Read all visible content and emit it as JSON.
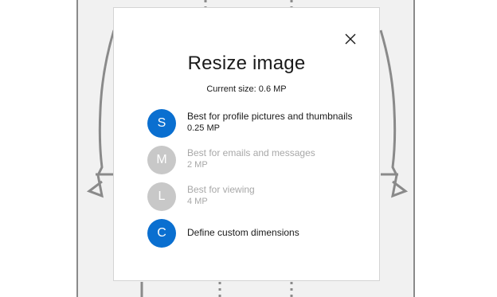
{
  "dialog": {
    "title": "Resize image",
    "current_size": "Current size: 0.6 MP",
    "close_icon": "close-icon"
  },
  "options": [
    {
      "letter": "S",
      "label": "Best for profile pictures and thumbnails",
      "size": "0.25 MP",
      "enabled": true
    },
    {
      "letter": "M",
      "label": "Best for emails and messages",
      "size": "2 MP",
      "enabled": false
    },
    {
      "letter": "L",
      "label": "Best for viewing",
      "size": "4 MP",
      "enabled": false
    },
    {
      "letter": "C",
      "label": "Define custom dimensions",
      "size": "",
      "enabled": true
    }
  ],
  "colors": {
    "accent": "#0a6fd0",
    "disabled_circle": "#c8c8c8",
    "disabled_text": "#a8a8a8",
    "backdrop": "#f1f1f1"
  }
}
